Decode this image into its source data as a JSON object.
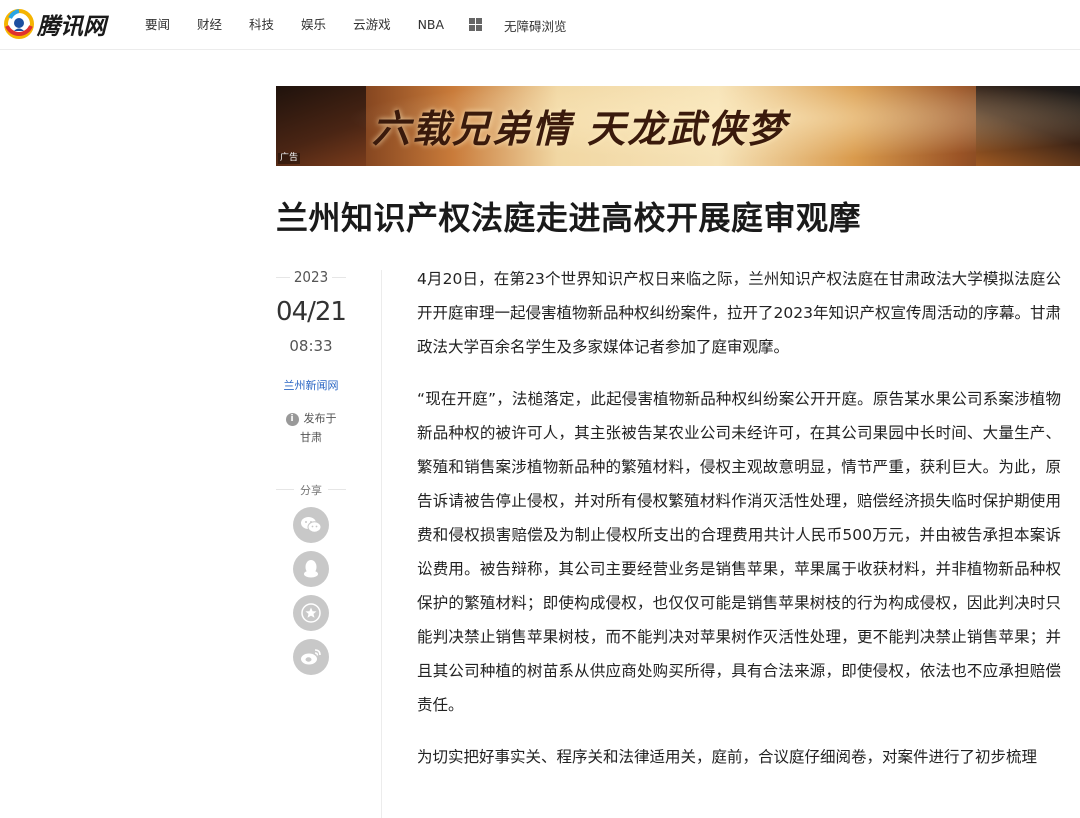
{
  "header": {
    "logo_text": "腾讯网",
    "nav": [
      "要闻",
      "财经",
      "科技",
      "娱乐",
      "云游戏",
      "NBA"
    ],
    "apps_icon": "grid-icon",
    "accessibility_label": "无障碍浏览"
  },
  "banner": {
    "text": "六载兄弟情 天龙武侠梦",
    "ad_label": "广告"
  },
  "article": {
    "title": "兰州知识产权法庭走进高校开展庭审观摩",
    "meta": {
      "year": "2023",
      "date": "04/21",
      "time": "08:33",
      "source": "兰州新闻网",
      "published_label": "发布于",
      "location": "甘肃",
      "share_label": "分享",
      "share_icons": [
        "wechat-icon",
        "qq-icon",
        "favorite-star-icon",
        "weibo-icon"
      ]
    },
    "paragraphs": [
      "4月20日，在第23个世界知识产权日来临之际，兰州知识产权法庭在甘肃政法大学模拟法庭公开开庭审理一起侵害植物新品种权纠纷案件，拉开了2023年知识产权宣传周活动的序幕。甘肃政法大学百余名学生及多家媒体记者参加了庭审观摩。",
      "“现在开庭”，法槌落定，此起侵害植物新品种权纠纷案公开开庭。原告某水果公司系案涉植物新品种权的被许可人，其主张被告某农业公司未经许可，在其公司果园中长时间、大量生产、繁殖和销售案涉植物新品种的繁殖材料，侵权主观故意明显，情节严重，获利巨大。为此，原告诉请被告停止侵权，并对所有侵权繁殖材料作消灭活性处理，赔偿经济损失临时保护期使用费和侵权损害赔偿及为制止侵权所支出的合理费用共计人民币500万元，并由被告承担本案诉讼费用。被告辩称，其公司主要经营业务是销售苹果，苹果属于收获材料，并非植物新品种权保护的繁殖材料；即使构成侵权，也仅仅可能是销售苹果树枝的行为构成侵权，因此判决时只能判决禁止销售苹果树枝，而不能判决对苹果树作灭活性处理，更不能判决禁止销售苹果；并且其公司种植的树苗系从供应商处购买所得，具有合法来源，即使侵权，依法也不应承担赔偿责任。",
      "为切实把好事实关、程序关和法律适用关，庭前，合议庭仔细阅卷，对案件进行了初步梳理"
    ]
  },
  "colors": {
    "link": "#2a66c4",
    "share_button": "#c8c8c8"
  }
}
